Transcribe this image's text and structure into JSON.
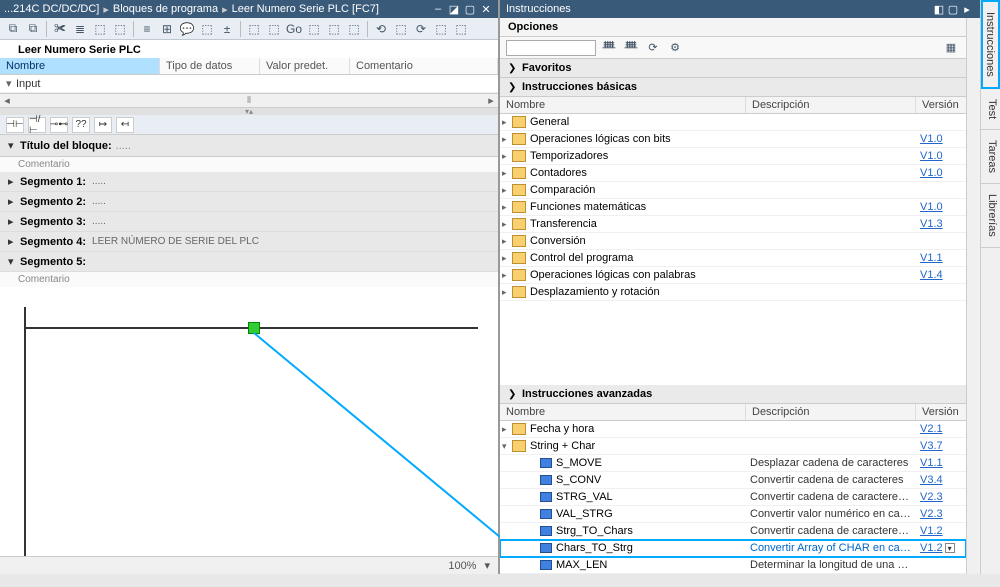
{
  "left": {
    "breadcrumb": [
      "...214C DC/DC/DC]",
      "Bloques de programa",
      "Leer Numero Serie PLC [FC7]"
    ],
    "block_name": "Leer Numero Serie PLC",
    "iface_cols": {
      "nombre": "Nombre",
      "tipo": "Tipo de datos",
      "valor": "Valor predet.",
      "com": "Comentario"
    },
    "iface_row": "Input",
    "block_title_label": "Título del bloque:",
    "comment_label": "Comentario",
    "segments": [
      {
        "label": "Segmento 1:",
        "desc": "....."
      },
      {
        "label": "Segmento 2:",
        "desc": "....."
      },
      {
        "label": "Segmento 3:",
        "desc": "....."
      },
      {
        "label": "Segmento 4:",
        "desc": "LEER NÚMERO DE SERIE DEL PLC"
      },
      {
        "label": "Segmento 5:",
        "desc": ""
      }
    ],
    "zoom": "100%"
  },
  "right": {
    "title": "Instrucciones",
    "opciones": "Opciones",
    "favoritos": "Favoritos",
    "basicas": "Instrucciones básicas",
    "avanzadas": "Instrucciones avanzadas",
    "cols": {
      "nombre": "Nombre",
      "desc": "Descripción",
      "ver": "Versión"
    },
    "basic_items": [
      {
        "caret": "▸",
        "type": "folder",
        "name": "General",
        "ver": ""
      },
      {
        "caret": "▸",
        "type": "folder",
        "name": "Operaciones lógicas con bits",
        "ver": "V1.0"
      },
      {
        "caret": "▸",
        "type": "folder",
        "name": "Temporizadores",
        "ver": "V1.0"
      },
      {
        "caret": "▸",
        "type": "folder",
        "name": "Contadores",
        "ver": "V1.0"
      },
      {
        "caret": "▸",
        "type": "folder",
        "name": "Comparación",
        "ver": ""
      },
      {
        "caret": "▸",
        "type": "folder",
        "name": "Funciones matemáticas",
        "ver": "V1.0"
      },
      {
        "caret": "▸",
        "type": "folder",
        "name": "Transferencia",
        "ver": "V1.3"
      },
      {
        "caret": "▸",
        "type": "folder",
        "name": "Conversión",
        "ver": ""
      },
      {
        "caret": "▸",
        "type": "folder",
        "name": "Control del programa",
        "ver": "V1.1"
      },
      {
        "caret": "▸",
        "type": "folder",
        "name": "Operaciones lógicas con palabras",
        "ver": "V1.4"
      },
      {
        "caret": "▸",
        "type": "folder",
        "name": "Desplazamiento y rotación",
        "ver": ""
      }
    ],
    "adv_items": [
      {
        "indent": 0,
        "caret": "▸",
        "type": "folder",
        "name": "Fecha y hora",
        "desc": "",
        "ver": "V2.1"
      },
      {
        "indent": 0,
        "caret": "▾",
        "type": "folder",
        "name": "String + Char",
        "desc": "",
        "ver": "V3.7"
      },
      {
        "indent": 1,
        "caret": "",
        "type": "block",
        "name": "S_MOVE",
        "desc": "Desplazar cadena de caracteres",
        "ver": "V1.1"
      },
      {
        "indent": 1,
        "caret": "",
        "type": "block",
        "name": "S_CONV",
        "desc": "Convertir cadena de caracteres",
        "ver": "V3.4"
      },
      {
        "indent": 1,
        "caret": "",
        "type": "block",
        "name": "STRG_VAL",
        "desc": "Convertir cadena de caracteres e..",
        "ver": "V2.3"
      },
      {
        "indent": 1,
        "caret": "",
        "type": "block",
        "name": "VAL_STRG",
        "desc": "Convertir valor numérico en cad...",
        "ver": "V2.3"
      },
      {
        "indent": 1,
        "caret": "",
        "type": "block",
        "name": "Strg_TO_Chars",
        "desc": "Convertir cadena de caracteres e..",
        "ver": "V1.2"
      },
      {
        "indent": 1,
        "caret": "",
        "type": "block",
        "name": "Chars_TO_Strg",
        "desc": "Convertir Array of CHAR en cade...",
        "ver": "V1.2",
        "hl": true,
        "dd": true
      },
      {
        "indent": 1,
        "caret": "",
        "type": "block",
        "name": "MAX_LEN",
        "desc": "Determinar la longitud de una ca..",
        "ver": ""
      }
    ]
  },
  "sidebar_tabs": [
    "Instrucciones",
    "Test",
    "Tareas",
    "Librerías"
  ]
}
